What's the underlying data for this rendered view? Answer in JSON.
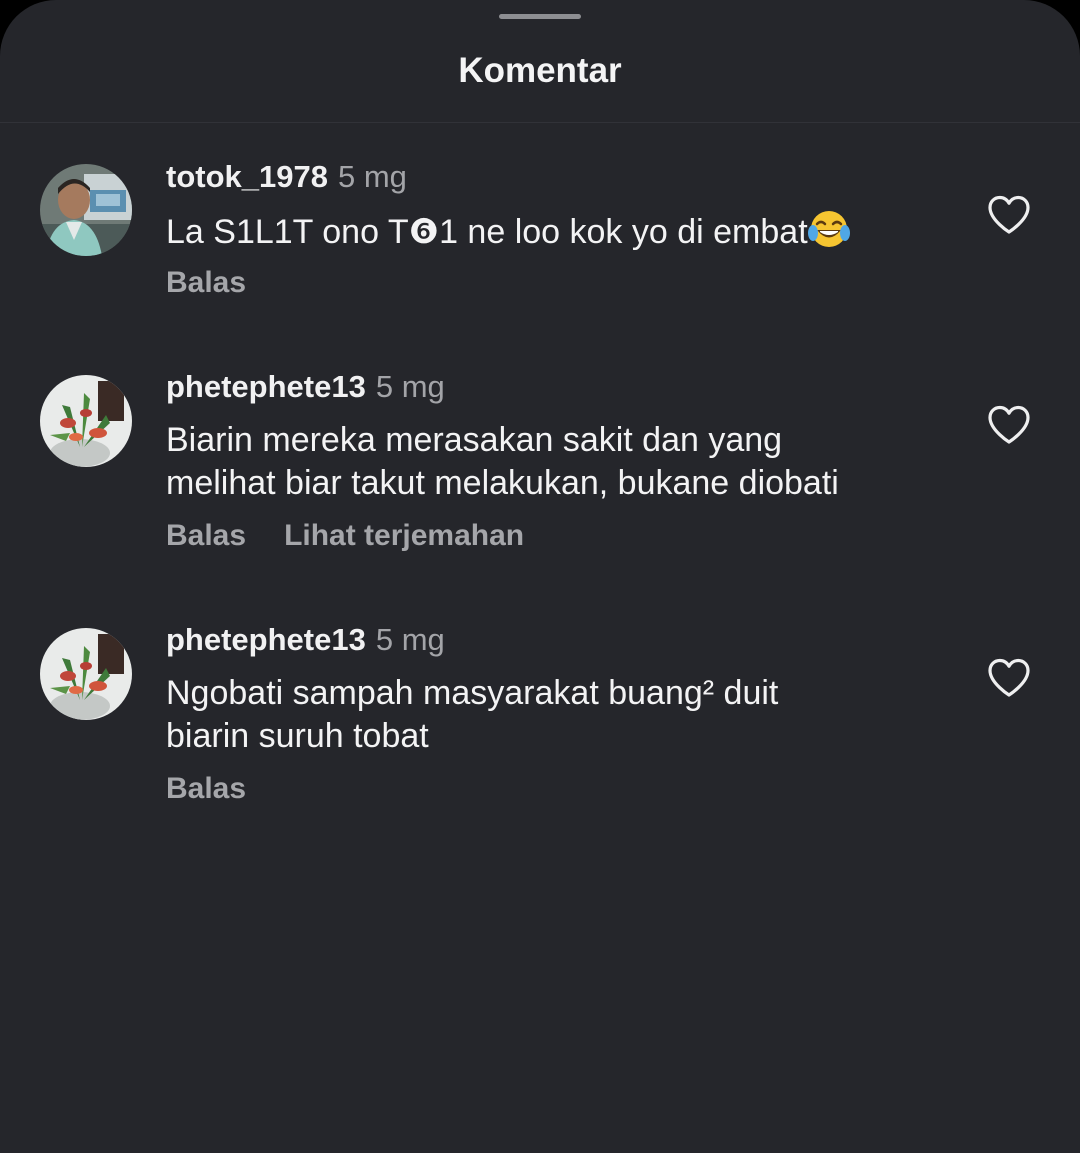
{
  "sheet": {
    "title": "Komentar"
  },
  "comments": [
    {
      "username": "totok_1978",
      "time": "5 mg",
      "text": "La S1L1T ono T❻1 ne loo kok yo di embat",
      "emoji": "face-with-tears-of-joy",
      "reply_label": "Balas",
      "like_icon": "heart-outline-icon"
    },
    {
      "username": "phetephete13",
      "time": "5 mg",
      "text_line1": "Biarin mereka merasakan sakit dan yang",
      "text_line2": "melihat biar takut melakukan, bukane diobati",
      "reply_label": "Balas",
      "translate_label": "Lihat terjemahan",
      "like_icon": "heart-outline-icon"
    },
    {
      "username": "phetephete13",
      "time": "5 mg",
      "text_line1": "Ngobati sampah masyarakat buang² duit",
      "text_line2": "biarin suruh tobat",
      "reply_label": "Balas",
      "like_icon": "heart-outline-icon"
    }
  ],
  "colors": {
    "background": "#25262b",
    "primary_text": "#f3f3f4",
    "secondary_text": "#a5a6aa"
  }
}
